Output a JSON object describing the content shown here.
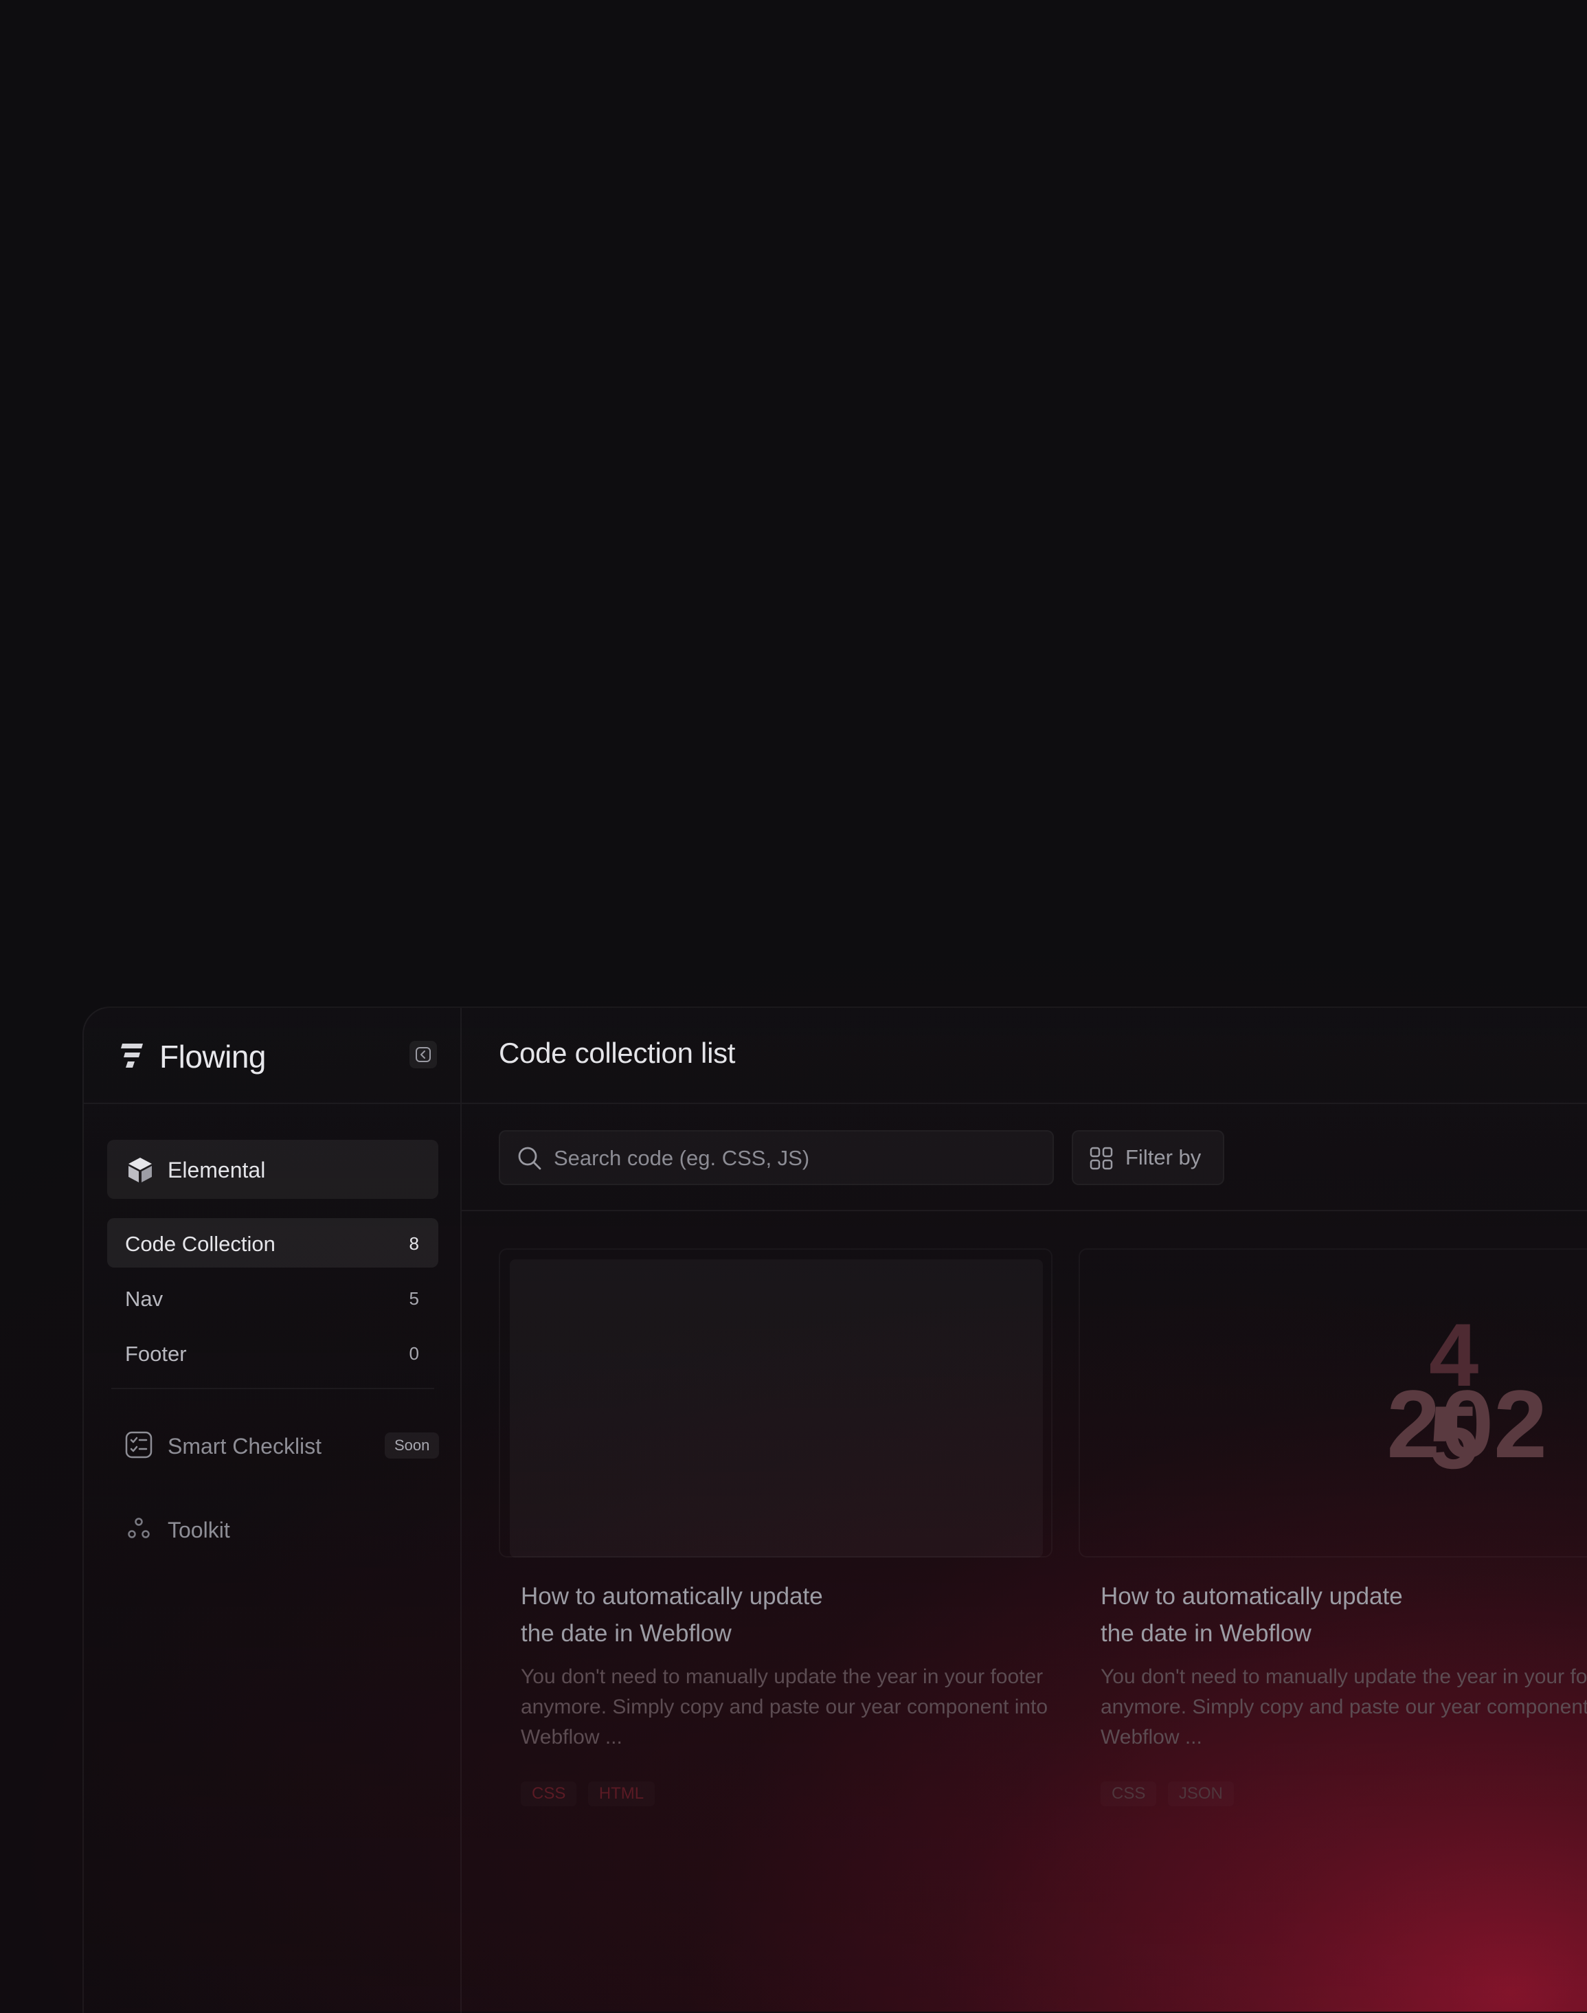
{
  "brand": {
    "name": "Flowing",
    "logo_icon": "flowing-logo-icon",
    "collapse_icon": "chevron-left-icon"
  },
  "sidebar": {
    "section": {
      "label": "Elemental",
      "icon": "cube-icon"
    },
    "items": [
      {
        "label": "Code Collection",
        "count": "8",
        "active": true
      },
      {
        "label": "Nav",
        "count": "5",
        "active": false
      },
      {
        "label": "Footer",
        "count": "0",
        "active": false
      }
    ],
    "tools": [
      {
        "label": "Smart Checklist",
        "icon": "checklist-icon",
        "badge": "Soon"
      },
      {
        "label": "Toolkit",
        "icon": "toolkit-icon"
      }
    ]
  },
  "main": {
    "title": "Code collection list",
    "search": {
      "value": "",
      "placeholder": "Search code (eg. CSS, JS)",
      "icon": "search-icon"
    },
    "filter": {
      "label": "Filter by",
      "icon": "grid-icon"
    },
    "cards": [
      {
        "title_line1": "How to automatically update",
        "title_line2": "the date in Webflow",
        "description": "You don't need to manually update the year in your footer anymore. Simply copy and paste our year component into Webflow ...",
        "tags": [
          "CSS",
          "HTML"
        ],
        "thumbnail": "blank"
      },
      {
        "title_line1": "How to automatically update",
        "title_line2": "the date in Webflow",
        "description": "You don't need to manually update the year in your footer anymore. Simply copy and paste our year component into Webflow ...",
        "tags": [
          "CSS",
          "JSON"
        ],
        "thumbnail": "year",
        "thumbnail_text": {
          "base": "202",
          "old_digit": "4",
          "new_digit": "5"
        }
      }
    ]
  },
  "colors": {
    "background": "#0e0d10",
    "accent_glow": "#8e1630",
    "text_primary": "#e6e6ea",
    "text_muted": "#8e8e96"
  }
}
